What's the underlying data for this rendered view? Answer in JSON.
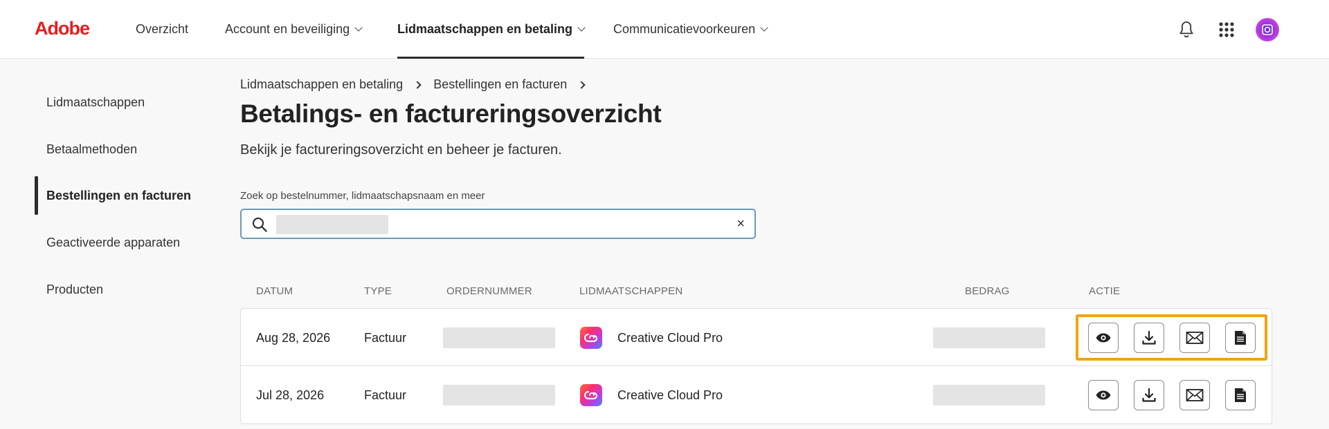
{
  "brand": {
    "logo_text": "Adobe",
    "logo_color": "#e61e1e"
  },
  "topnav": {
    "items": [
      {
        "label": "Overzicht",
        "dropdown": false,
        "active": false
      },
      {
        "label": "Account en beveiliging",
        "dropdown": true,
        "active": false
      },
      {
        "label": "Lidmaatschappen en betaling",
        "dropdown": true,
        "active": true
      },
      {
        "label": "Communicatievoorkeuren",
        "dropdown": true,
        "active": false
      }
    ],
    "icons": [
      "bell-icon",
      "app-grid-icon",
      "avatar"
    ]
  },
  "sidebar": {
    "items": [
      {
        "label": "Lidmaatschappen",
        "active": false
      },
      {
        "label": "Betaalmethoden",
        "active": false
      },
      {
        "label": "Bestellingen en facturen",
        "active": true
      },
      {
        "label": "Geactiveerde apparaten",
        "active": false
      },
      {
        "label": "Producten",
        "active": false
      }
    ]
  },
  "breadcrumb": [
    "Lidmaatschappen en betaling",
    "Bestellingen en facturen"
  ],
  "page": {
    "title": "Betalings- en factureringsoverzicht",
    "subtitle": "Bekijk je factureringsoverzicht en beheer je facturen."
  },
  "search": {
    "label": "Zoek op bestelnummer, lidmaatschapsnaam en meer",
    "value_redacted": true,
    "clear_glyph": "×"
  },
  "table": {
    "headers": {
      "date": "DATUM",
      "type": "TYPE",
      "order": "ORDERNUMMER",
      "membership": "LIDMAATSCHAPPEN",
      "amount": "BEDRAG",
      "action": "ACTIE"
    },
    "rows": [
      {
        "date": "Aug 28, 2026",
        "type": "Factuur",
        "order_redacted": true,
        "membership": "Creative Cloud Pro",
        "amount_redacted": true
      },
      {
        "date": "Jul 28, 2026",
        "type": "Factuur",
        "order_redacted": true,
        "membership": "Creative Cloud Pro",
        "amount_redacted": true
      }
    ],
    "action_icons": [
      "eye-icon",
      "download-icon",
      "mail-icon",
      "document-icon"
    ],
    "highlight_color": "#f5a20f"
  }
}
